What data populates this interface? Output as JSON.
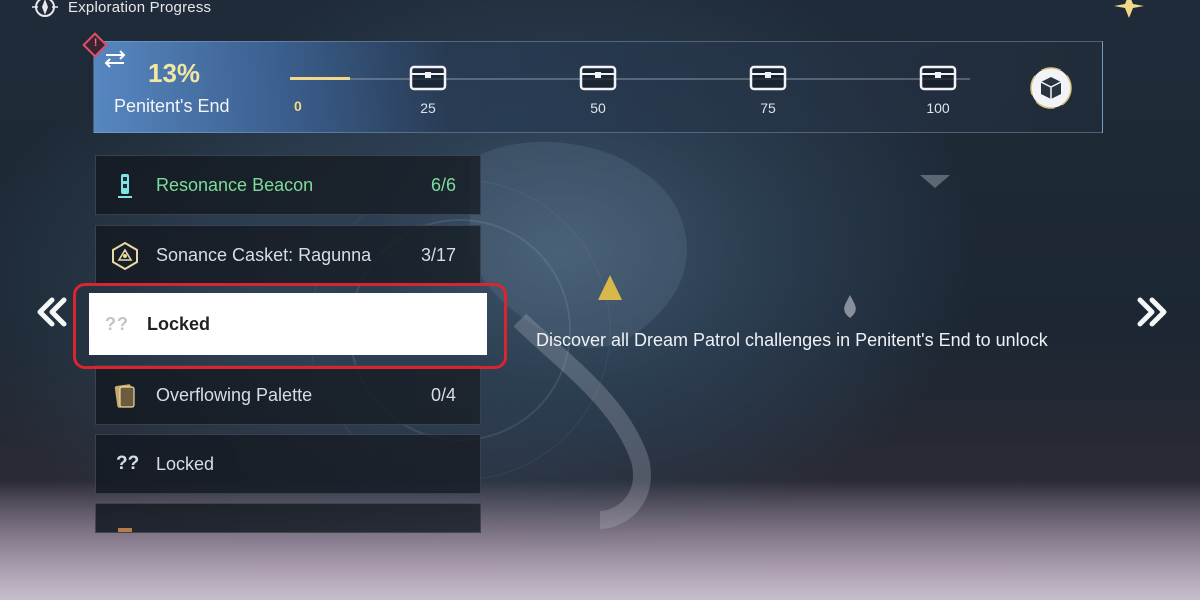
{
  "header": {
    "title": "Exploration Progress",
    "icon": "compass-icon"
  },
  "banner": {
    "percent": "13%",
    "region": "Penitent's End",
    "alert": "!",
    "progress_fraction": 0.13,
    "milestones": [
      "0",
      "25",
      "50",
      "75",
      "100"
    ]
  },
  "list": {
    "items": [
      {
        "label": "Resonance Beacon",
        "count": "6/6",
        "icon": "beacon-icon",
        "color": "#7ddc9a"
      },
      {
        "label": "Sonance Casket: Ragunna",
        "count": "3/17",
        "icon": "casket-icon"
      },
      {
        "label": "Locked",
        "prefix": "??",
        "icon": "question-icon",
        "selected": true
      },
      {
        "label": "Overflowing Palette",
        "count": "0/4",
        "icon": "palette-icon"
      },
      {
        "label": "Locked",
        "prefix": "??",
        "icon": "question-icon"
      }
    ]
  },
  "hint": {
    "text": "Discover all Dream Patrol challenges in Penitent's End to unlock"
  },
  "nav": {
    "prev": "previous-region-icon",
    "next": "next-region-icon"
  },
  "colors": {
    "accent_gold": "#f0d98a",
    "highlight_red": "#d7262f",
    "complete_green": "#7ddc9a"
  }
}
